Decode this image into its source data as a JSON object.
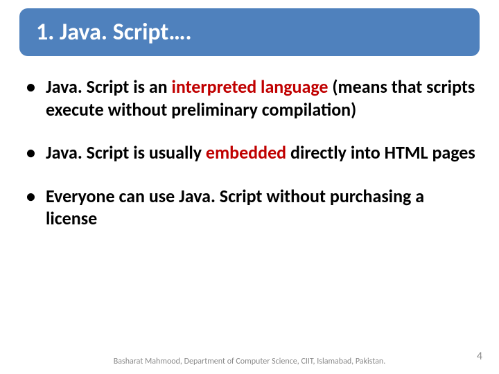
{
  "title": "1. Java. Script…. ",
  "bullets": [
    {
      "pre": "Java. Script is an ",
      "hl": "interpreted language ",
      "post": "(means that scripts execute without preliminary compilation)"
    },
    {
      "pre": "Java. Script is usually ",
      "hl": "embedded ",
      "post": "directly into HTML pages"
    },
    {
      "pre": "Everyone can use Java. Script without purchasing a license",
      "hl": "",
      "post": ""
    }
  ],
  "footer": "Basharat Mahmood, Department of Computer Science, CIIT, Islamabad, Pakistan.",
  "page": "4"
}
